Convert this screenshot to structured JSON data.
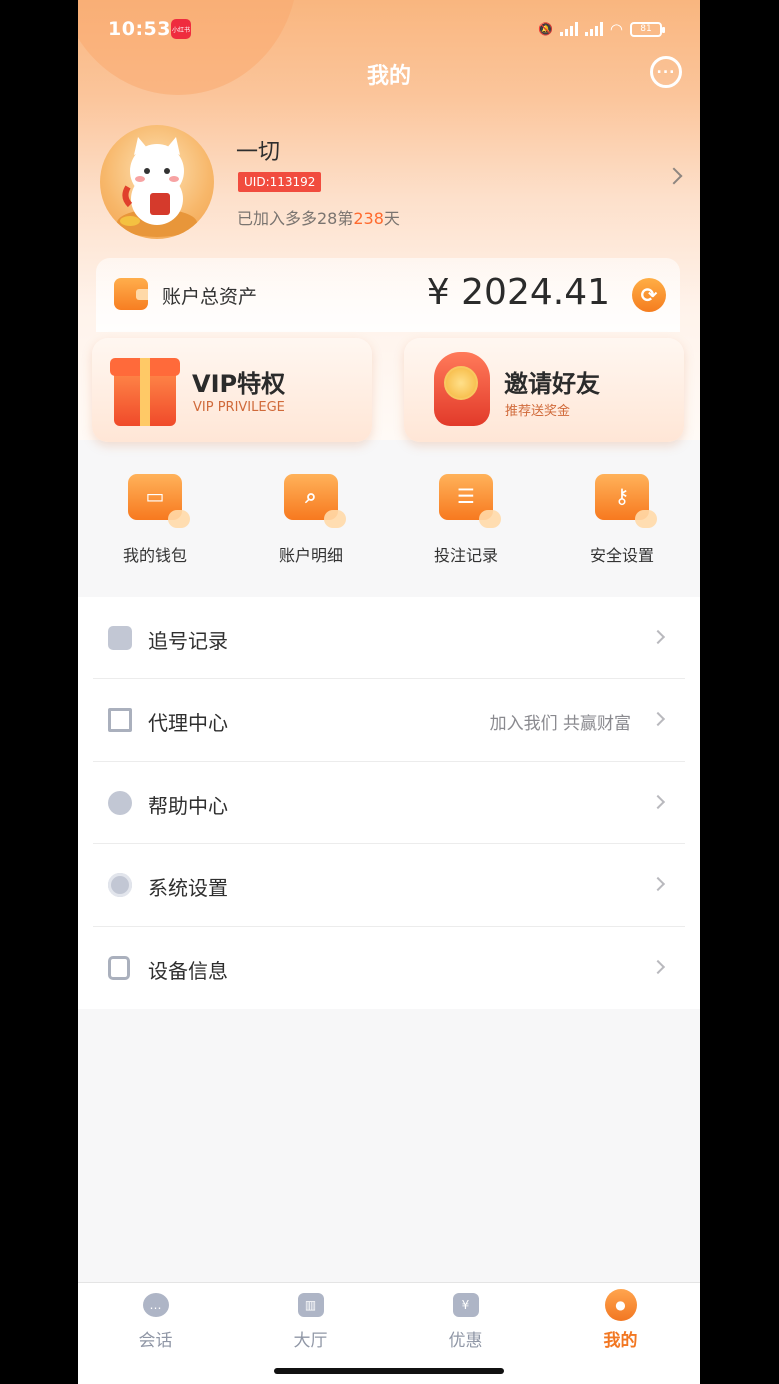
{
  "status_bar": {
    "time": "10:53",
    "app_badge": "小红书",
    "battery": "81"
  },
  "header": {
    "title": "我的"
  },
  "profile": {
    "name": "一切",
    "uid": "UID:113192",
    "joined_prefix": "已加入多多28第",
    "joined_days": "238",
    "joined_suffix": "天"
  },
  "assets": {
    "label": "账户总资产",
    "value": "¥ 2024.41"
  },
  "promos": [
    {
      "title": "VIP特权",
      "subtitle": "VIP PRIVILEGE"
    },
    {
      "title": "邀请好友",
      "subtitle": "推荐送奖金"
    }
  ],
  "quick_actions": [
    {
      "label": "我的钱包",
      "icon": "wallet-icon"
    },
    {
      "label": "账户明细",
      "icon": "magnifier-icon"
    },
    {
      "label": "投注记录",
      "icon": "ticket-icon"
    },
    {
      "label": "安全设置",
      "icon": "key-icon"
    }
  ],
  "menu": [
    {
      "label": "追号记录",
      "extra": "",
      "icon": "clipboard-icon"
    },
    {
      "label": "代理中心",
      "extra": "加入我们 共赢财富",
      "icon": "qr-code-icon"
    },
    {
      "label": "帮助中心",
      "extra": "",
      "icon": "question-icon"
    },
    {
      "label": "系统设置",
      "extra": "",
      "icon": "gear-icon"
    },
    {
      "label": "设备信息",
      "extra": "",
      "icon": "tablet-icon"
    }
  ],
  "tabs": [
    {
      "label": "会话",
      "icon": "chat-bubble-icon"
    },
    {
      "label": "大厅",
      "icon": "bank-icon"
    },
    {
      "label": "优惠",
      "icon": "yen-ticket-icon"
    },
    {
      "label": "我的",
      "icon": "user-icon",
      "active": true
    }
  ],
  "colors": {
    "accent": "#f27722",
    "highlight": "#ff6a2e",
    "uid_badge": "#f14c3e"
  }
}
